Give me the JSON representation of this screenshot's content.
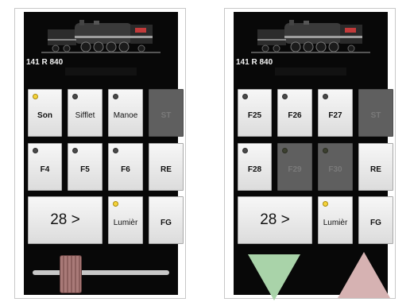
{
  "locomotive": {
    "id": "141 R 840"
  },
  "colors": {
    "led_on": "#f5d33a",
    "led_off": "#4a4a4a",
    "arrow_down": "#a9d3a9",
    "arrow_up": "#d6b2b2"
  },
  "left_panel": {
    "buttons": {
      "son": "Son",
      "sifflet": "Sifflet",
      "manoe": "Manoe",
      "st": "ST",
      "f4": "F4",
      "f5": "F5",
      "f6": "F6",
      "re": "RE",
      "speed": "28 >",
      "lumiere": "Lumièr",
      "fg": "FG"
    }
  },
  "right_panel": {
    "buttons": {
      "f25": "F25",
      "f26": "F26",
      "f27": "F27",
      "st": "ST",
      "f28": "F28",
      "f29": "F29",
      "f30": "F30",
      "re": "RE",
      "speed": "28 >",
      "lumiere": "Lumièr",
      "fg": "FG"
    }
  }
}
